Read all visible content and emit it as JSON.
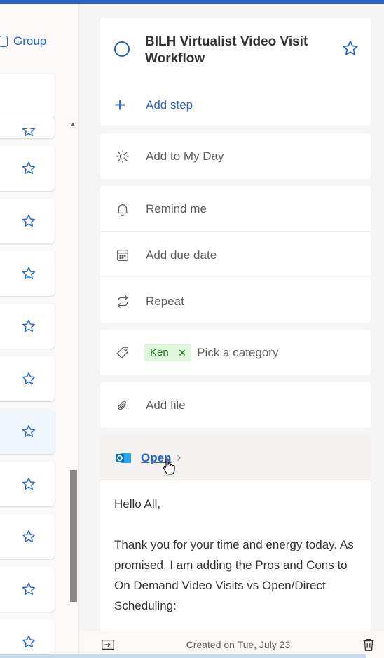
{
  "colors": {
    "accent": "#2564cf",
    "chip_bg": "#dff6dd",
    "chip_text": "#107c10"
  },
  "left_panel": {
    "group_label": "Group",
    "rows": [
      {
        "icon": "star-icon",
        "selected": false
      },
      {
        "icon": "star-icon",
        "selected": false
      },
      {
        "icon": "star-icon",
        "selected": false
      },
      {
        "icon": "star-icon",
        "selected": false
      },
      {
        "icon": "star-icon",
        "selected": false
      },
      {
        "icon": "star-icon",
        "selected": false
      },
      {
        "icon": "star-icon",
        "selected": true
      },
      {
        "icon": "star-icon",
        "selected": false
      },
      {
        "icon": "star-icon",
        "selected": false
      },
      {
        "icon": "star-icon",
        "selected": false
      },
      {
        "icon": "star-icon",
        "selected": false
      }
    ]
  },
  "task": {
    "title": "BILH Virtualist Video Visit Workflow",
    "add_step": "Add step"
  },
  "actions": {
    "my_day": "Add to My Day",
    "remind": "Remind me",
    "due_date": "Add due date",
    "repeat": "Repeat",
    "category_chip": "Ken",
    "category_placeholder": "Pick a category",
    "add_file": "Add file"
  },
  "note": {
    "open_label": "Open",
    "greeting": "Hello All,",
    "body": "Thank you for your time and energy today. As promised, I am adding the Pros and Cons to On Demand Video Visits vs Open/Direct Scheduling:"
  },
  "footer": {
    "created": "Created on Tue, July 23"
  }
}
